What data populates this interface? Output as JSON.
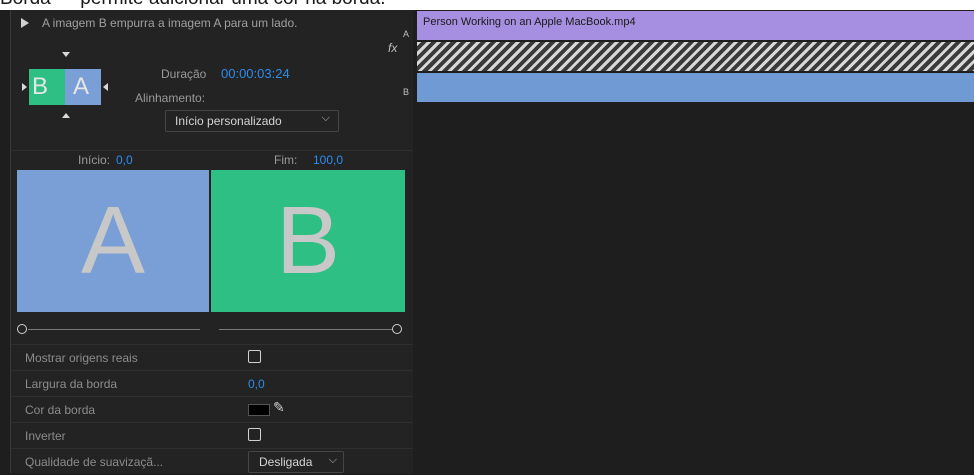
{
  "caption": "Borda — permite adicionar uma cor na borda.",
  "effect": {
    "description": "A imagem B empurra a imagem A para um lado.",
    "thumb_b": "B",
    "thumb_a": "A",
    "duration_label": "Duração",
    "duration_value": "00:00:03:24",
    "alignment_label": "Alinhamento:",
    "alignment_value": "Início personalizado"
  },
  "range": {
    "start_label": "Início:",
    "start_value": "0,0",
    "end_label": "Fim:",
    "end_value": "100,0",
    "preview_a": "A",
    "preview_b": "B"
  },
  "properties": {
    "show_actual": "Mostrar origens reais",
    "border_width_label": "Largura da borda",
    "border_width_value": "0,0",
    "border_color_label": "Cor da borda",
    "invert_label": "Inverter",
    "antialias_label": "Qualidade de suavizaçã...",
    "antialias_value": "Desligada"
  },
  "timeline": {
    "track_a": "A",
    "fx": "fx",
    "track_b": "B",
    "clip_a_name": "Person Working on an Apple MacBook.mp4"
  },
  "colors": {
    "clip_a": "#a68fe0",
    "clip_b": "#6f9ad3",
    "preview_a": "#7a9fd6",
    "preview_b": "#2dbf83",
    "accent_value": "#2d8ceb"
  },
  "icons": [
    "play-icon",
    "dropdown-chevron-icon",
    "eyedropper-icon",
    "checkbox-icon"
  ]
}
